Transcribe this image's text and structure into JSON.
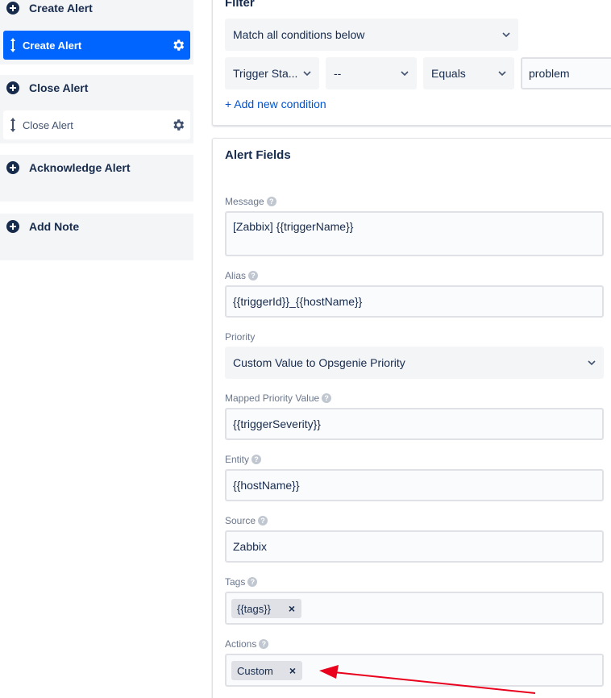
{
  "sidebar": {
    "groups": [
      {
        "title": "Create Alert",
        "items": [
          {
            "label": "Create Alert",
            "active": true
          }
        ]
      },
      {
        "title": "Close Alert",
        "items": [
          {
            "label": "Close Alert",
            "active": false
          }
        ]
      },
      {
        "title": "Acknowledge Alert",
        "items": []
      },
      {
        "title": "Add Note",
        "items": []
      }
    ]
  },
  "filter": {
    "title": "Filter",
    "match_select": "Match all conditions below",
    "condition": {
      "field": "Trigger Sta...",
      "not": "--",
      "operator": "Equals",
      "value": "problem"
    },
    "add_condition": "+ Add new condition"
  },
  "alert_fields": {
    "title": "Alert Fields",
    "message": {
      "label": "Message",
      "value": "[Zabbix] {{triggerName}}"
    },
    "alias": {
      "label": "Alias",
      "value": "{{triggerId}}_{{hostName}}"
    },
    "priority": {
      "label": "Priority",
      "value": "Custom Value to Opsgenie Priority"
    },
    "mapped_priority": {
      "label": "Mapped Priority Value",
      "value": "{{triggerSeverity}}"
    },
    "entity": {
      "label": "Entity",
      "value": "{{hostName}}"
    },
    "source": {
      "label": "Source",
      "value": "Zabbix"
    },
    "tags": {
      "label": "Tags",
      "chips": [
        "{{tags}}"
      ]
    },
    "actions": {
      "label": "Actions",
      "chips": [
        "Custom"
      ]
    }
  },
  "help_glyph": "?",
  "remove_glyph": "×",
  "colors": {
    "accent": "#0065ff",
    "link": "#0052cc",
    "annotation_arrow": "#e8001d"
  }
}
